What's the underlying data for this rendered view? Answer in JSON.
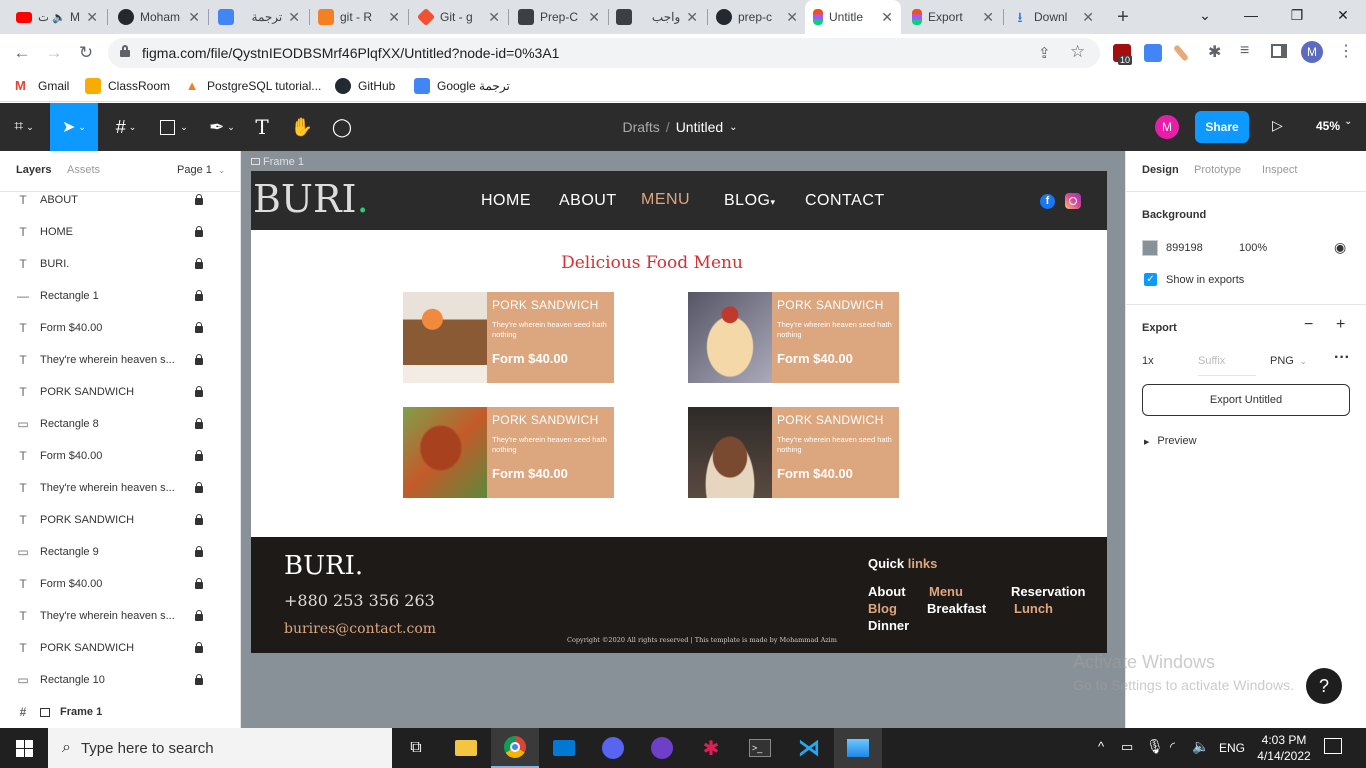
{
  "browser": {
    "tabs": [
      {
        "label": "Moham",
        "color": "#ff0000",
        "prefix": "ات"
      },
      {
        "label": "Moham",
        "color": "#24292f"
      },
      {
        "label": "ترجمة",
        "color": "#4285f4"
      },
      {
        "label": "git - R",
        "color": "#f48024"
      },
      {
        "label": "Git - g",
        "color": "#f05133"
      },
      {
        "label": "Prep-C",
        "color": "#3c4043"
      },
      {
        "label": "واجب",
        "color": "#3c4043"
      },
      {
        "label": "prep-c",
        "color": "#24292f"
      },
      {
        "label": "Untitle",
        "color": "#a259ff"
      },
      {
        "label": "Export",
        "color": "#a259ff"
      },
      {
        "label": "Downl",
        "color": "#1a73e8"
      }
    ],
    "url": "figma.com/file/QystnIEODBSMrf46PlqfXX/Untitled?node-id=0%3A1",
    "extension_badge": "10",
    "profile_initial": "M",
    "bookmarks": [
      {
        "label": "Gmail",
        "color": "#ea4335"
      },
      {
        "label": "ClassRoom",
        "color": "#f9ab00"
      },
      {
        "label": "PostgreSQL tutorial...",
        "color": "#f48024"
      },
      {
        "label": "GitHub",
        "color": "#24292f"
      },
      {
        "label": "Google ترجمة",
        "color": "#4285f4"
      }
    ]
  },
  "figma": {
    "breadcrumb_parent": "Drafts",
    "breadcrumb_sep": "/",
    "file_name": "Untitled",
    "avatar_initial": "M",
    "share_label": "Share",
    "zoom": "45%",
    "left_tabs": {
      "layers": "Layers",
      "assets": "Assets",
      "page": "Page 1"
    },
    "layers": [
      {
        "icon": "T",
        "name": "ABOUT"
      },
      {
        "icon": "T",
        "name": "HOME"
      },
      {
        "icon": "T",
        "name": "BURI."
      },
      {
        "icon": "—",
        "name": "Rectangle 1"
      },
      {
        "icon": "T",
        "name": "Form $40.00"
      },
      {
        "icon": "T",
        "name": "They're wherein heaven s..."
      },
      {
        "icon": "T",
        "name": "PORK SANDWICH"
      },
      {
        "icon": "▭",
        "name": "Rectangle 8"
      },
      {
        "icon": "T",
        "name": "Form $40.00"
      },
      {
        "icon": "T",
        "name": "They're wherein heaven s..."
      },
      {
        "icon": "T",
        "name": "PORK SANDWICH"
      },
      {
        "icon": "▭",
        "name": "Rectangle 9"
      },
      {
        "icon": "T",
        "name": "Form $40.00"
      },
      {
        "icon": "T",
        "name": "They're wherein heaven s..."
      },
      {
        "icon": "T",
        "name": "PORK SANDWICH"
      },
      {
        "icon": "▭",
        "name": "Rectangle 10"
      }
    ],
    "frame_layer": "Frame 1",
    "frame_label": "Frame 1",
    "right_tabs": {
      "design": "Design",
      "prototype": "Prototype",
      "inspect": "Inspect"
    },
    "background_title": "Background",
    "background_hex": "899198",
    "background_opacity": "100%",
    "background_color": "#899198",
    "show_in_exports": "Show in exports",
    "export_title": "Export",
    "export_scale": "1x",
    "export_suffix": "Suffix",
    "export_format": "PNG",
    "export_button": "Export Untitled",
    "preview_label": "Preview",
    "watermark_title": "Activate Windows",
    "watermark_sub": "Go to Settings to activate Windows.",
    "help": "?"
  },
  "site": {
    "logo": "BURI",
    "logo_dot": ".",
    "nav": {
      "home": "HOME",
      "about": "ABOUT",
      "menu": "MENU",
      "blog": "BLOG",
      "contact": "CONTACT"
    },
    "heading": "Delicious Food Menu",
    "cards": [
      {
        "title": "PORK SANDWICH",
        "desc": "They're wherein heaven seed hath nothing",
        "price": "Form $40.00"
      },
      {
        "title": "PORK SANDWICH",
        "desc": "They're wherein heaven seed hath nothing",
        "price": "Form $40.00"
      },
      {
        "title": "PORK SANDWICH",
        "desc": "They're wherein heaven seed hath nothing",
        "price": "Form $40.00"
      },
      {
        "title": "PORK SANDWICH",
        "desc": "They're wherein heaven seed hath nothing",
        "price": "Form $40.00"
      }
    ],
    "footer": {
      "logo": "BURI.",
      "phone": "+880 253 356 263",
      "email": "burires@contact.com",
      "quick": "Quick",
      "links_word": "links",
      "links": {
        "about": "About",
        "menu": "Menu",
        "reservation": "Reservation",
        "blog": "Blog",
        "breakfast": "Breakfast",
        "lunch": "Lunch",
        "dinner": "Dinner"
      },
      "copyright": "Copyright ©2020 All rights reserved | This template is made by Mohammad Azim"
    },
    "accent": "#dca67e",
    "heading_color": "#d62f2f"
  },
  "taskbar": {
    "search_placeholder": "Type here to search",
    "time": "4:03 PM",
    "date": "4/14/2022",
    "lang": "ENG"
  }
}
